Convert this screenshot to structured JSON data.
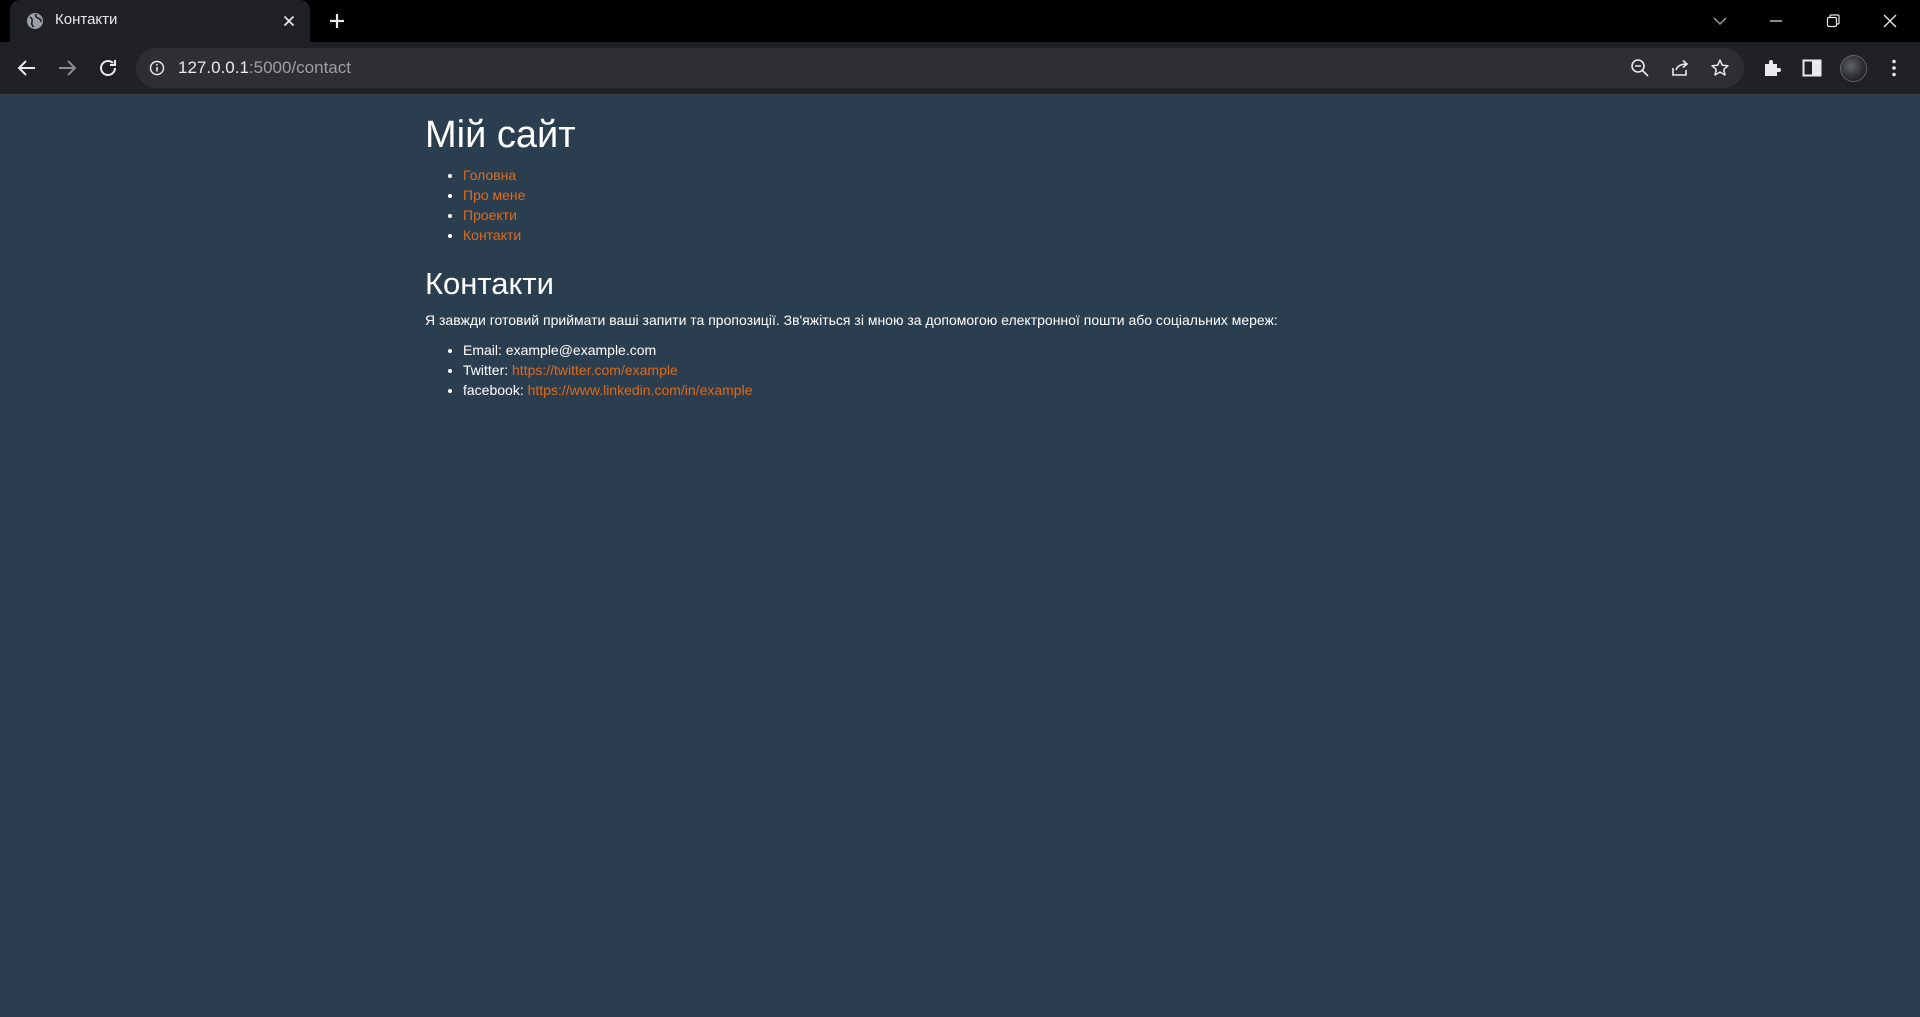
{
  "browser": {
    "tab_title": "Контакти",
    "url_host": "127.0.0.1",
    "url_rest": ":5000/contact",
    "icons": {
      "favicon": "globe-icon",
      "tab_close": "close-icon",
      "new_tab": "plus-icon",
      "tab_search": "chevron-down-icon",
      "minimize": "minimize-icon",
      "restore": "restore-icon",
      "close_window": "close-icon",
      "back": "back-arrow-icon",
      "forward": "forward-arrow-icon",
      "reload": "reload-icon",
      "site_info": "info-icon",
      "zoom": "zoom-out-icon",
      "share": "share-icon",
      "bookmark": "star-icon",
      "extensions": "puzzle-icon",
      "side_panel": "side-panel-icon",
      "profile": "avatar",
      "menu": "kebab-menu-icon"
    }
  },
  "page": {
    "site_title": "Мій сайт",
    "nav": [
      {
        "label": "Головна"
      },
      {
        "label": "Про мене"
      },
      {
        "label": "Проекти"
      },
      {
        "label": "Контакти"
      }
    ],
    "heading": "Контакти",
    "intro": "Я завжди готовий приймати ваші запити та пропозиції. Зв'яжіться зі мною за допомогою електронної пошти або соціальних мереж:",
    "contacts": [
      {
        "label": "Email:",
        "value": "example@example.com"
      },
      {
        "label": "Twitter:",
        "link": "https://twitter.com/example"
      },
      {
        "label": "facebook:",
        "link": "https://www.linkedin.com/in/example"
      }
    ]
  },
  "colors": {
    "page_background": "#2b3e50",
    "link": "#df691a",
    "text": "#ffffff",
    "chrome_dark": "#202124"
  }
}
